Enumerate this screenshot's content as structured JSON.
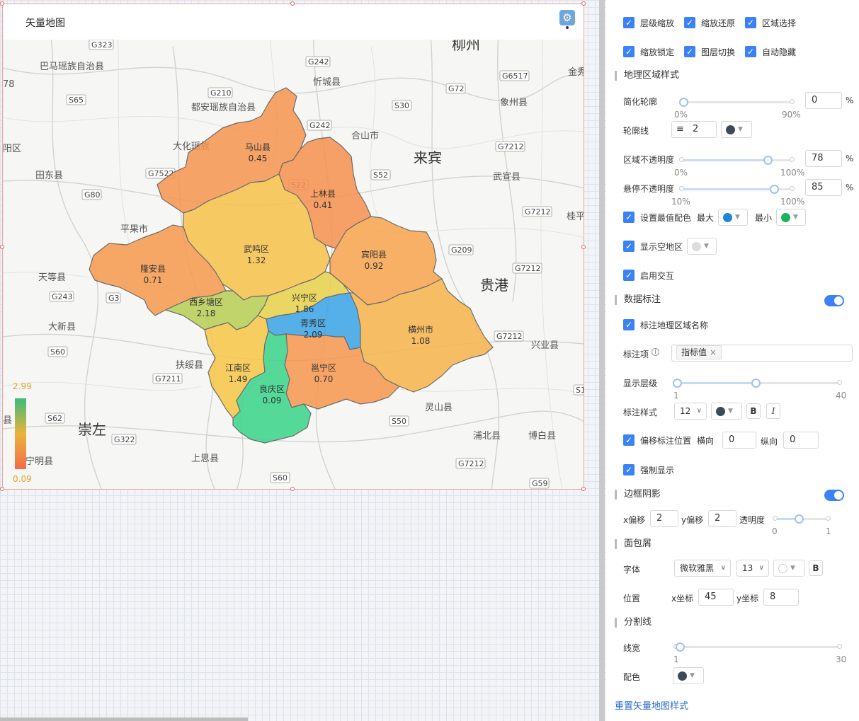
{
  "widget": {
    "title": "矢量地图",
    "gear_icon": "gear-icon",
    "legend": {
      "max": "2.99",
      "min": "0.09",
      "max_color": "#3dbb7a",
      "min_color": "#f36b4a"
    }
  },
  "map": {
    "regions": [
      {
        "name": "马山县",
        "value": "0.45",
        "color": "#f7954f"
      },
      {
        "name": "上林县",
        "value": "0.41",
        "color": "#f7904f"
      },
      {
        "name": "武鸣区",
        "value": "1.32",
        "color": "#f8c24a"
      },
      {
        "name": "宾阳县",
        "value": "0.92",
        "color": "#f8a44e"
      },
      {
        "name": "隆安县",
        "value": "0.71",
        "color": "#f79a4e"
      },
      {
        "name": "西乡塘区",
        "value": "2.18",
        "color": "#b8cf55"
      },
      {
        "name": "兴宁区",
        "value": "1.86",
        "color": "#e8d24a"
      },
      {
        "name": "青秀区",
        "value": "2.09",
        "color": "#3aa3e8"
      },
      {
        "name": "横州市",
        "value": "1.08",
        "color": "#f8b44c"
      },
      {
        "name": "江南区",
        "value": "1.49",
        "color": "#f8c647"
      },
      {
        "name": "邕宁区",
        "value": "0.70",
        "color": "#f7974e"
      },
      {
        "name": "良庆区",
        "value": "0.09",
        "color": "#3ad58a"
      }
    ],
    "basemap_labels": [
      {
        "text": "柳州",
        "big": true
      },
      {
        "text": "巴马瑶族自治县"
      },
      {
        "text": "忻城县"
      },
      {
        "text": "象州县"
      },
      {
        "text": "都安瑶族自治县"
      },
      {
        "text": "合山市"
      },
      {
        "text": "大化瑶族"
      },
      {
        "text": "来宾",
        "big": true
      },
      {
        "text": "武宣县"
      },
      {
        "text": "田东县"
      },
      {
        "text": "平果市"
      },
      {
        "text": "天等县"
      },
      {
        "text": "贵港",
        "big": true
      },
      {
        "text": "大新县"
      },
      {
        "text": "扶绥县"
      },
      {
        "text": "兴业县"
      },
      {
        "text": "崇左",
        "big": true
      },
      {
        "text": "灵山县"
      },
      {
        "text": "浦北县"
      },
      {
        "text": "博白县"
      },
      {
        "text": "上思县"
      },
      {
        "text": "宁明县"
      },
      {
        "text": "金秀"
      },
      {
        "text": "桂平"
      },
      {
        "text": "阳区"
      },
      {
        "text": "县"
      },
      {
        "text": "78"
      }
    ],
    "road_tags": [
      "G323",
      "G242",
      "G6517",
      "G210",
      "G72",
      "S65",
      "S30",
      "G242",
      "G7212",
      "G7522",
      "S52",
      "G80",
      "G7212",
      "S22",
      "G209",
      "G7212",
      "G3",
      "G243",
      "S60",
      "G7211",
      "G7212",
      "S62",
      "S50",
      "G322",
      "G7212",
      "S60",
      "G59",
      "S1"
    ]
  },
  "panel": {
    "interaction": {
      "row1": [
        "层级缩放",
        "缩放还原",
        "区域选择"
      ],
      "row2": [
        "缩放锁定",
        "图层切换",
        "自动隐藏"
      ]
    },
    "geo_style": {
      "heading": "地理区域样式",
      "simplify": {
        "label": "简化轮廓",
        "value": "0",
        "unit": "%",
        "min": "0%",
        "max": "90%",
        "level": 0
      },
      "outline": {
        "label": "轮廓线",
        "value": "2",
        "color": "#3c4a5a",
        "lines_icon": "lines-icon"
      },
      "area_opacity": {
        "label": "区域不透明度",
        "value": "78",
        "unit": "%",
        "min": "0%",
        "max": "100%",
        "level": 0.78
      },
      "hover_opacity": {
        "label": "悬停不透明度",
        "value": "85",
        "unit": "%",
        "min": "10%",
        "max": "100%",
        "level": 0.85
      },
      "extreme": {
        "label": "设置最值配色",
        "max_label": "最大",
        "max_color": "#1e86d6",
        "min_label": "最小",
        "min_color": "#18b55a"
      },
      "empty": {
        "label": "显示空地区",
        "color": "#dcdcdc"
      },
      "interactive": {
        "label": "启用交互"
      }
    },
    "data_label": {
      "heading": "数据标注",
      "name_label": "标注地理区域名称",
      "items_label": "标注项",
      "items_info_icon": "info-icon",
      "tag": "指标值",
      "level": {
        "label": "显示层级",
        "min": "1",
        "max": "40",
        "level": 0.3
      },
      "style": {
        "label": "标注样式",
        "size": "12",
        "color": "#3c4a5a",
        "bold": "B",
        "italic": "I"
      },
      "offset": {
        "label": "偏移标注位置",
        "h_label": "横向",
        "h_value": "0",
        "v_label": "纵向",
        "v_value": "0"
      },
      "force": {
        "label": "强制显示"
      }
    },
    "border_shadow": {
      "heading": "边框阴影",
      "x_label": "x偏移",
      "x_value": "2",
      "y_label": "y偏移",
      "y_value": "2",
      "opacity_label": "透明度",
      "opacity_min": "0",
      "opacity_max": "1",
      "level": 0.5
    },
    "breadcrumb": {
      "heading": "面包屑",
      "font_label": "字体",
      "font_value": "微软雅黑",
      "size_value": "13",
      "bold": "B",
      "pos_label": "位置",
      "x_label": "x坐标",
      "x_value": "45",
      "y_label": "y坐标",
      "y_value": "8"
    },
    "divider": {
      "heading": "分割线",
      "width": {
        "label": "线宽",
        "min": "1",
        "max": "30",
        "level": 0.02
      },
      "color_label": "配色",
      "color": "#3c4a5a"
    },
    "reset": "重置矢量地图样式"
  }
}
